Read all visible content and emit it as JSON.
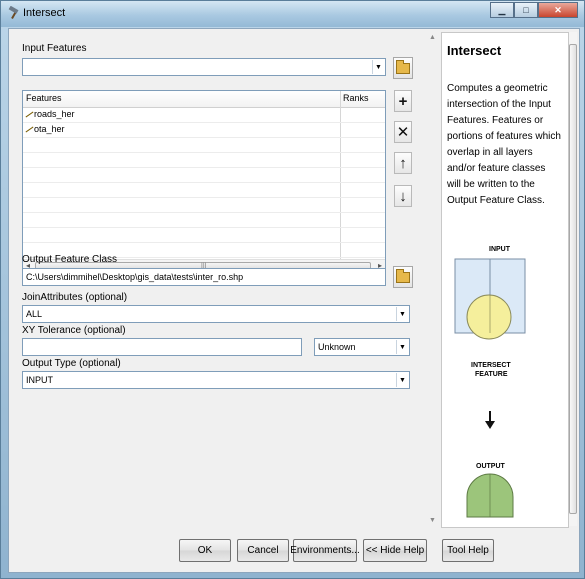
{
  "window": {
    "title": "Intersect"
  },
  "input_features": {
    "label": "Input Features",
    "value": "",
    "table": {
      "columns": [
        "Features",
        "Ranks"
      ],
      "rows": [
        {
          "feature": "roads_her",
          "rank": ""
        },
        {
          "feature": "ota_her",
          "rank": ""
        }
      ]
    }
  },
  "output_feature_class": {
    "label": "Output Feature Class",
    "value": "C:\\Users\\dimmihel\\Desktop\\gis_data\\tests\\inter_ro.shp"
  },
  "join_attributes": {
    "label": "JoinAttributes (optional)",
    "value": "ALL"
  },
  "xy_tolerance": {
    "label": "XY Tolerance (optional)",
    "value": "",
    "unit": "Unknown"
  },
  "output_type": {
    "label": "Output Type (optional)",
    "value": "INPUT"
  },
  "help": {
    "title": "Intersect",
    "body": "Computes a geometric intersection of the Input Features. Features or portions of features which overlap in all layers and/or feature classes will be written to the Output Feature Class.",
    "diagram": {
      "input_label": "INPUT",
      "intersect_label_1": "INTERSECT",
      "intersect_label_2": "FEATURE",
      "output_label": "OUTPUT"
    }
  },
  "buttons": {
    "ok": "OK",
    "cancel": "Cancel",
    "environments": "Environments...",
    "hide_help": "<< Hide Help",
    "tool_help": "Tool Help"
  },
  "colors": {
    "input_fill": "#dbe9f7",
    "circle_fill": "#f5ef9c",
    "output_fill": "#9cc57b"
  }
}
